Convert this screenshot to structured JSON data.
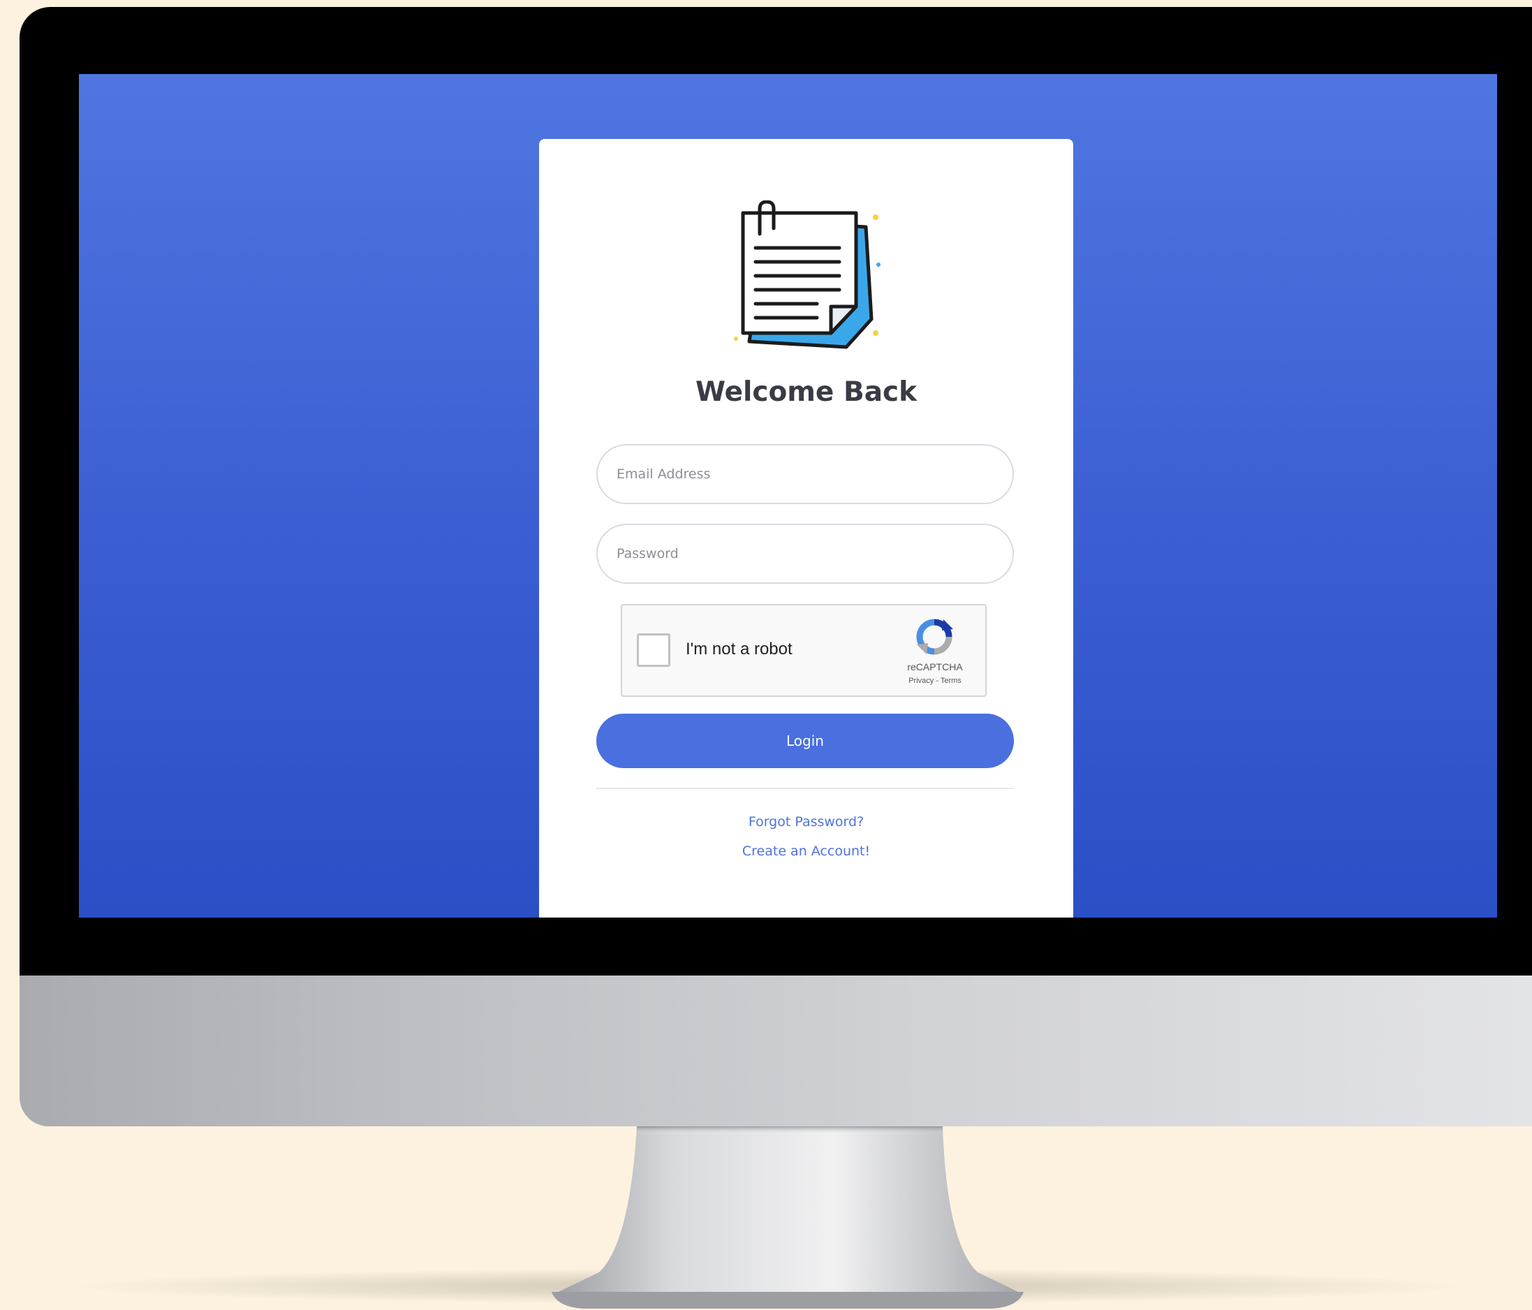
{
  "login_card": {
    "title": "Welcome Back",
    "email_placeholder": "Email Address",
    "password_placeholder": "Password",
    "login_label": "Login",
    "forgot_password_label": "Forgot Password?",
    "create_account_label": "Create an Account!",
    "logo_icon": "notepad-document-icon"
  },
  "captcha": {
    "label": "I'm not a robot",
    "brand": "reCAPTCHA",
    "links": "Privacy - Terms",
    "icon": "recaptcha-icon"
  },
  "colors": {
    "screen_top": "#4f76e0",
    "screen_bottom": "#2a4fc6",
    "accent": "#4a6fdf",
    "link": "#4e73df",
    "page_background": "#fcf2df"
  }
}
